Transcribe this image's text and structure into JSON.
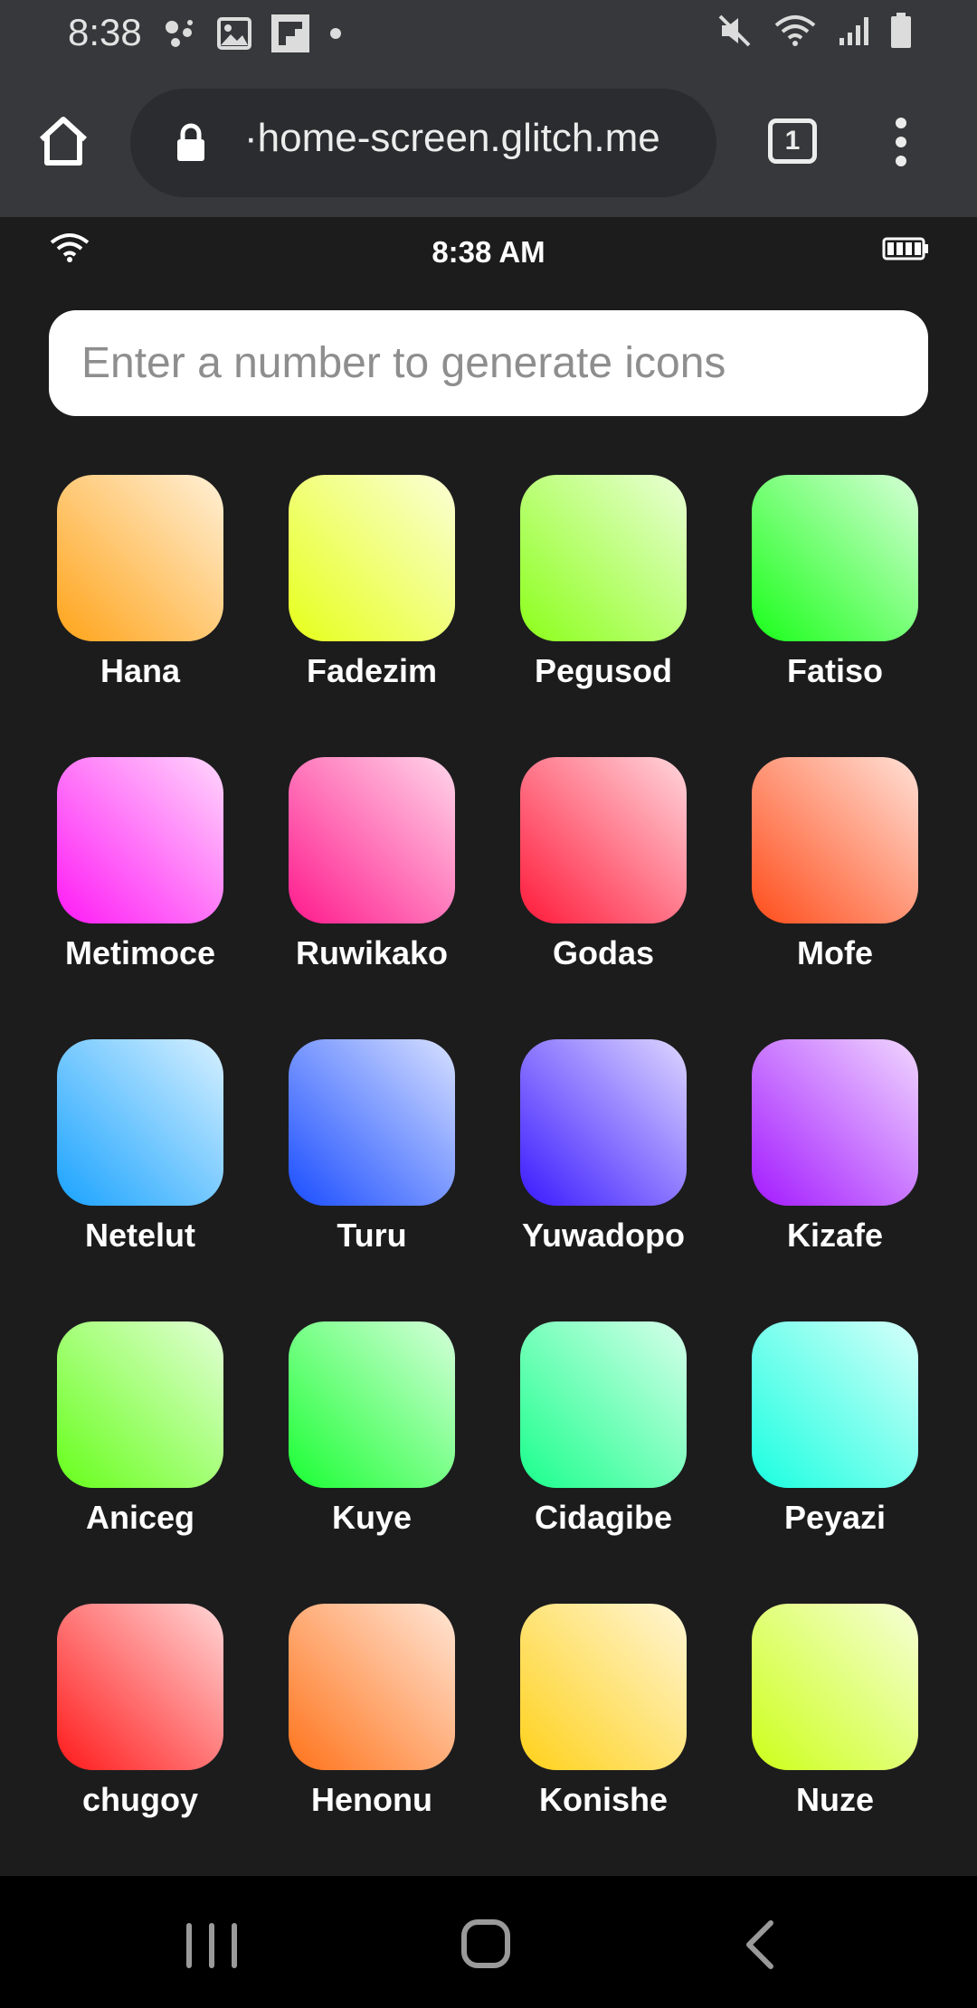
{
  "android_status": {
    "time": "8:38"
  },
  "browser": {
    "url": "·home-screen.glitch.me",
    "tab_count": "1"
  },
  "simulated_status": {
    "time": "8:38 AM"
  },
  "search": {
    "placeholder": "Enter a number to generate icons"
  },
  "apps": [
    {
      "name": "Hana",
      "from": "#ffa41a",
      "to": "#fff0d6"
    },
    {
      "name": "Fadezim",
      "from": "#e6ff1a",
      "to": "#fbffd6"
    },
    {
      "name": "Pegusod",
      "from": "#8cff1a",
      "to": "#eaffd6"
    },
    {
      "name": "Fatiso",
      "from": "#1aff1a",
      "to": "#d6ffd6"
    },
    {
      "name": "Metimoce",
      "from": "#ff1af5",
      "to": "#ffd6fc"
    },
    {
      "name": "Ruwikako",
      "from": "#ff1a8c",
      "to": "#ffd6ea"
    },
    {
      "name": "Godas",
      "from": "#ff1a3a",
      "to": "#ffd6dc"
    },
    {
      "name": "Mofe",
      "from": "#ff4d1a",
      "to": "#ffe0d6"
    },
    {
      "name": "Netelut",
      "from": "#1aa3ff",
      "to": "#d6f0ff"
    },
    {
      "name": "Turu",
      "from": "#1a4dff",
      "to": "#d6e0ff"
    },
    {
      "name": "Yuwadopo",
      "from": "#3a1aff",
      "to": "#ddd6ff"
    },
    {
      "name": "Kizafe",
      "from": "#a31aff",
      "to": "#f0d6ff"
    },
    {
      "name": "Aniceg",
      "from": "#66ff1a",
      "to": "#e3ffd6"
    },
    {
      "name": "Kuye",
      "from": "#1aff33",
      "to": "#d6ffdb"
    },
    {
      "name": "Cidagibe",
      "from": "#1aff8c",
      "to": "#d6ffea"
    },
    {
      "name": "Peyazi",
      "from": "#1affe0",
      "to": "#d6fffa"
    },
    {
      "name": "chugoy",
      "from": "#ff1a1a",
      "to": "#ffd6d6"
    },
    {
      "name": "Henonu",
      "from": "#ff731a",
      "to": "#ffe6d6"
    },
    {
      "name": "Konishe",
      "from": "#ffd11a",
      "to": "#fff6d6"
    },
    {
      "name": "Nuze",
      "from": "#ccff1a",
      "to": "#f6ffd6"
    }
  ]
}
